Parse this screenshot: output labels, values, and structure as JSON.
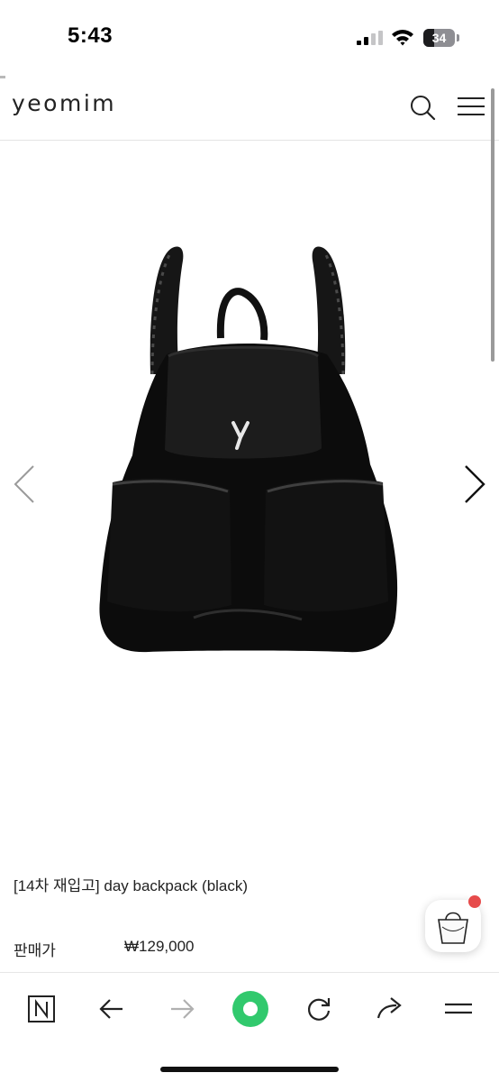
{
  "status_bar": {
    "time": "5:43",
    "battery_level": "34"
  },
  "header": {
    "logo": "yeomim",
    "search_icon": "search-icon",
    "menu_icon": "hamburger-menu-icon"
  },
  "gallery": {
    "prev_icon": "chevron-left-icon",
    "next_icon": "chevron-right-icon",
    "image": "black glossy backpack"
  },
  "product": {
    "title": "[14차 재입고] day backpack (black)",
    "price_label": "판매가",
    "price_value": "₩129,000"
  },
  "floating_cart": {
    "icon": "shopping-bag-icon",
    "badge_color": "#e64b4b"
  },
  "browser_toolbar": {
    "items": [
      "n-home-icon",
      "back-arrow-icon",
      "forward-arrow-icon",
      "green-circle-icon",
      "reload-icon",
      "share-icon",
      "menu-icon"
    ],
    "accent": "#31c96d"
  }
}
